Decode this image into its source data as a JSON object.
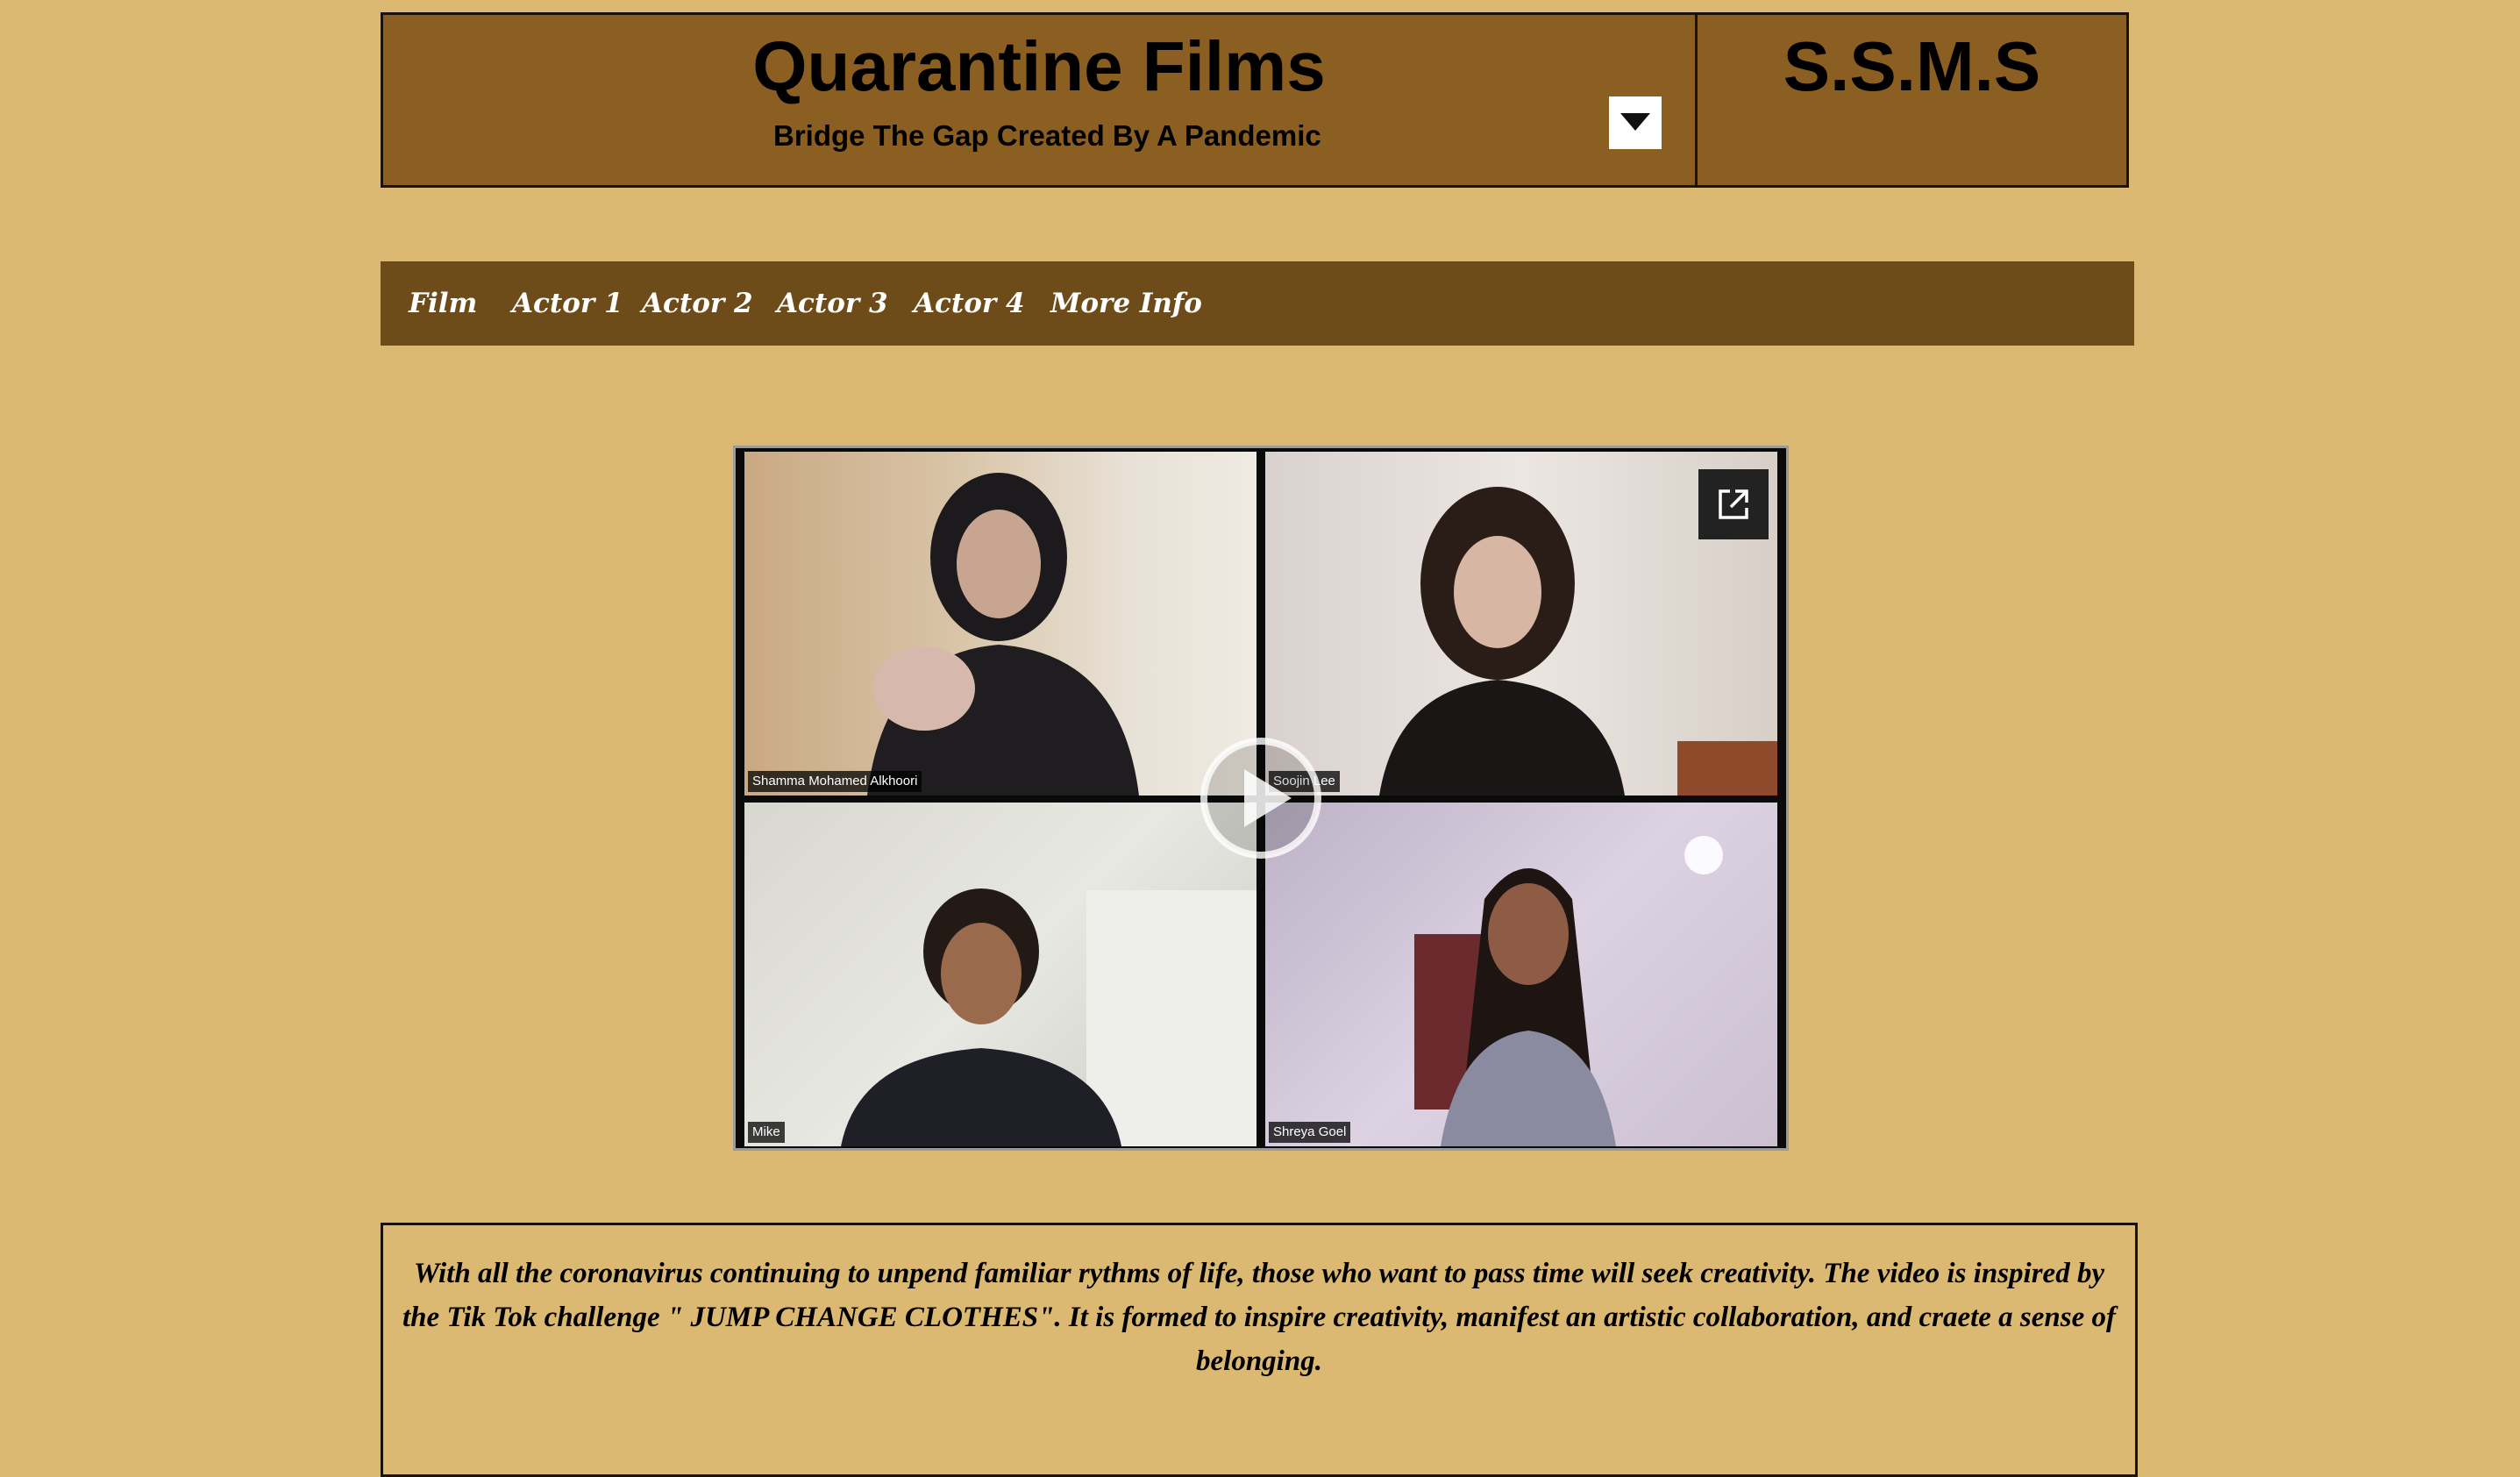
{
  "header": {
    "title": "Quarantine Films",
    "subtitle": "Bridge The Gap Created By A Pandemic",
    "side_title": "S.S.M.S",
    "dropdown_icon": "caret-down-icon"
  },
  "nav": {
    "items": [
      {
        "label": "Film"
      },
      {
        "label": "Actor 1"
      },
      {
        "label": "Actor 2"
      },
      {
        "label": "Actor 3"
      },
      {
        "label": "Actor 4"
      },
      {
        "label": "More Info"
      }
    ]
  },
  "video": {
    "participants": [
      {
        "name": "Shamma Mohamed Alkhoori"
      },
      {
        "name": "Soojin Lee"
      },
      {
        "name": "Mike"
      },
      {
        "name": "Shreya Goel"
      }
    ],
    "play_icon": "play-icon",
    "external_icon": "external-link-icon"
  },
  "description": {
    "text": "With all the coronavirus continuing to unpend familiar rythms of life, those who want to pass time will seek creativity. The video is inspired by the Tik Tok challenge \" JUMP CHANGE CLOTHES\". It is formed to inspire creativity, manifest an artistic collaboration, and craete a sense of belonging."
  },
  "colors": {
    "page_background": "#dbb972",
    "header_background": "#8a5f21",
    "nav_background": "#6e4c1a"
  }
}
